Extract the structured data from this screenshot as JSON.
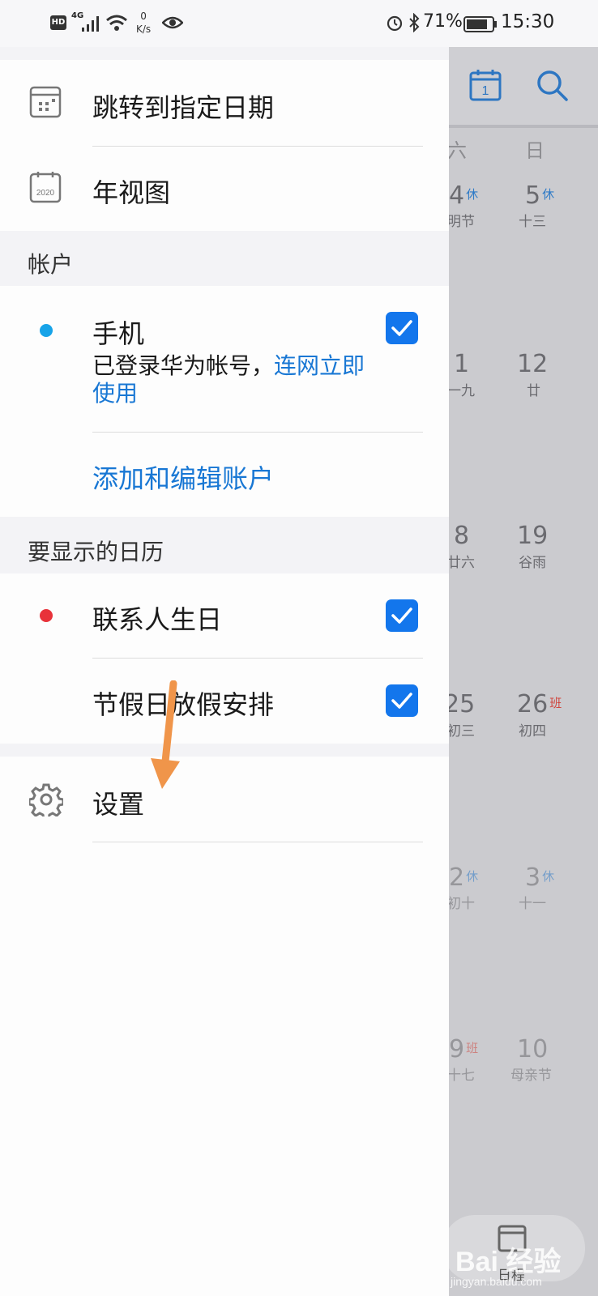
{
  "status_bar": {
    "hd": "HD",
    "net_type": "4G",
    "speed_value": "0",
    "speed_unit": "K/s",
    "battery": "71%",
    "time": "15:30"
  },
  "drawer": {
    "items_top": [
      {
        "label": "跳转到指定日期",
        "icon": "calendar-jump-icon"
      },
      {
        "label": "年视图",
        "icon": "year-view-icon",
        "icon_text": "2020"
      }
    ],
    "accounts": {
      "title": "帐户",
      "phone": {
        "name": "手机",
        "status_text": "已登录华为帐号，",
        "status_link": "连网立即使用",
        "checked": true,
        "dot_color": "#17a3e8"
      },
      "add_edit_label": "添加和编辑账户"
    },
    "calendars": {
      "title": "要显示的日历",
      "items": [
        {
          "label": "联系人生日",
          "checked": true,
          "dot_color": "#e8323a"
        },
        {
          "label": "节假日放假安排",
          "checked": true
        }
      ]
    },
    "settings_label": "设置"
  },
  "background_calendar": {
    "today_icon_text": "1",
    "weekdays": [
      "六",
      "日"
    ],
    "rows": [
      {
        "sat": {
          "day": "4",
          "tag": "休",
          "lunar": "明节"
        },
        "sun": {
          "day": "5",
          "tag": "休",
          "lunar": "十三"
        }
      },
      {
        "sat": {
          "day": "1",
          "tag": "",
          "lunar": "一九"
        },
        "sun": {
          "day": "12",
          "tag": "",
          "lunar": "廿"
        }
      },
      {
        "sat": {
          "day": "8",
          "tag": "",
          "lunar": "廿六"
        },
        "sun": {
          "day": "19",
          "tag": "",
          "lunar": "谷雨"
        }
      },
      {
        "sat": {
          "day": "25",
          "tag": "",
          "lunar": "初三"
        },
        "sun": {
          "day": "26",
          "tag": "班",
          "lunar": "初四"
        }
      },
      {
        "sat": {
          "day": "2",
          "tag": "休",
          "lunar": "初十"
        },
        "sun": {
          "day": "3",
          "tag": "休",
          "lunar": "十一"
        }
      },
      {
        "sat": {
          "day": "9",
          "tag": "班",
          "lunar": "十七"
        },
        "sun": {
          "day": "10",
          "tag": "",
          "lunar": "母亲节"
        }
      }
    ],
    "fab_label": "日程"
  },
  "watermark": {
    "brand": "Bai 经验",
    "url": "jingyan.baidu.com"
  },
  "colors": {
    "accent_blue": "#1376ec",
    "link_blue": "#1877d4",
    "annotation_arrow": "#f0954a"
  }
}
